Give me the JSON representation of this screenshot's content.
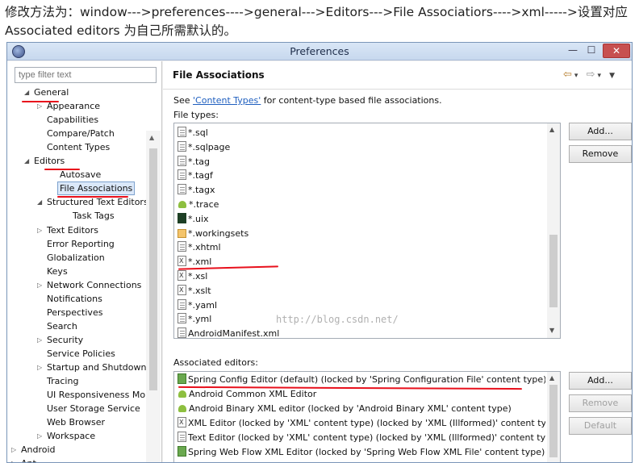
{
  "caption": "修改方法为：window--->preferences---->general--->Editors--->File Associatiors---->xml----->设置对应Associated editors 为自己所需默认的。",
  "window": {
    "title": "Preferences",
    "minimize_glyph": "—",
    "maximize_glyph": "☐",
    "close_glyph": "✕"
  },
  "filter": {
    "placeholder": "type filter text"
  },
  "tree": [
    {
      "label": "General",
      "toggle": "◢"
    },
    {
      "label": "Appearance",
      "toggle": "▷"
    },
    {
      "label": "Capabilities",
      "toggle": ""
    },
    {
      "label": "Compare/Patch",
      "toggle": ""
    },
    {
      "label": "Content Types",
      "toggle": ""
    },
    {
      "label": "Editors",
      "toggle": "◢"
    },
    {
      "label": "Autosave",
      "toggle": ""
    },
    {
      "label": "File Associations",
      "toggle": ""
    },
    {
      "label": "Structured Text Editors",
      "toggle": "◢"
    },
    {
      "label": "Task Tags",
      "toggle": ""
    },
    {
      "label": "Text Editors",
      "toggle": "▷"
    },
    {
      "label": "Error Reporting",
      "toggle": ""
    },
    {
      "label": "Globalization",
      "toggle": ""
    },
    {
      "label": "Keys",
      "toggle": ""
    },
    {
      "label": "Network Connections",
      "toggle": "▷"
    },
    {
      "label": "Notifications",
      "toggle": ""
    },
    {
      "label": "Perspectives",
      "toggle": ""
    },
    {
      "label": "Search",
      "toggle": ""
    },
    {
      "label": "Security",
      "toggle": "▷"
    },
    {
      "label": "Service Policies",
      "toggle": ""
    },
    {
      "label": "Startup and Shutdown",
      "toggle": "▷"
    },
    {
      "label": "Tracing",
      "toggle": ""
    },
    {
      "label": "UI Responsiveness Monitoring",
      "toggle": ""
    },
    {
      "label": "User Storage Service",
      "toggle": ""
    },
    {
      "label": "Web Browser",
      "toggle": ""
    },
    {
      "label": "Workspace",
      "toggle": "▷"
    },
    {
      "label": "Android",
      "toggle": "▷"
    },
    {
      "label": "Ant",
      "toggle": "▷"
    }
  ],
  "main": {
    "title": "File Associations",
    "nav": {
      "back": "⇦",
      "forward": "⇨",
      "dropdown": "▾",
      "menu": "▼"
    },
    "see_prefix": "See ",
    "see_link": "'Content Types'",
    "see_suffix": " for content-type based file associations.",
    "file_types_label": "File types:",
    "file_types": [
      "*.sql",
      "*.sqlpage",
      "*.tag",
      "*.tagf",
      "*.tagx",
      "*.trace",
      "*.uix",
      "*.workingsets",
      "*.xhtml",
      "*.xml",
      "*.xsl",
      "*.xslt",
      "*.yaml",
      "*.yml",
      "AndroidManifest.xml"
    ],
    "file_types_selected": "*.xml",
    "add_label": "Add...",
    "remove_label": "Remove",
    "assoc_label": "Associated editors:",
    "editors": [
      "Spring Config Editor (default) (locked by 'Spring Configuration File' content type)",
      "Android Common XML Editor",
      "Android Binary XML editor (locked by 'Android Binary XML' content type)",
      "XML Editor (locked by 'XML' content type) (locked by 'XML (Illformed)' content type) (locked",
      "Text Editor (locked by 'XML' content type) (locked by 'XML (Illformed)' content type) (locked",
      "Spring Web Flow XML Editor (locked by 'Spring Web Flow XML File' content type)"
    ],
    "editors_add_label": "Add...",
    "editors_remove_label": "Remove",
    "default_label": "Default"
  },
  "watermark": "http://blog.csdn.net/",
  "colors": {
    "annotation": "#e8101c",
    "link": "#1f5fbf",
    "close_button": "#c75050"
  }
}
